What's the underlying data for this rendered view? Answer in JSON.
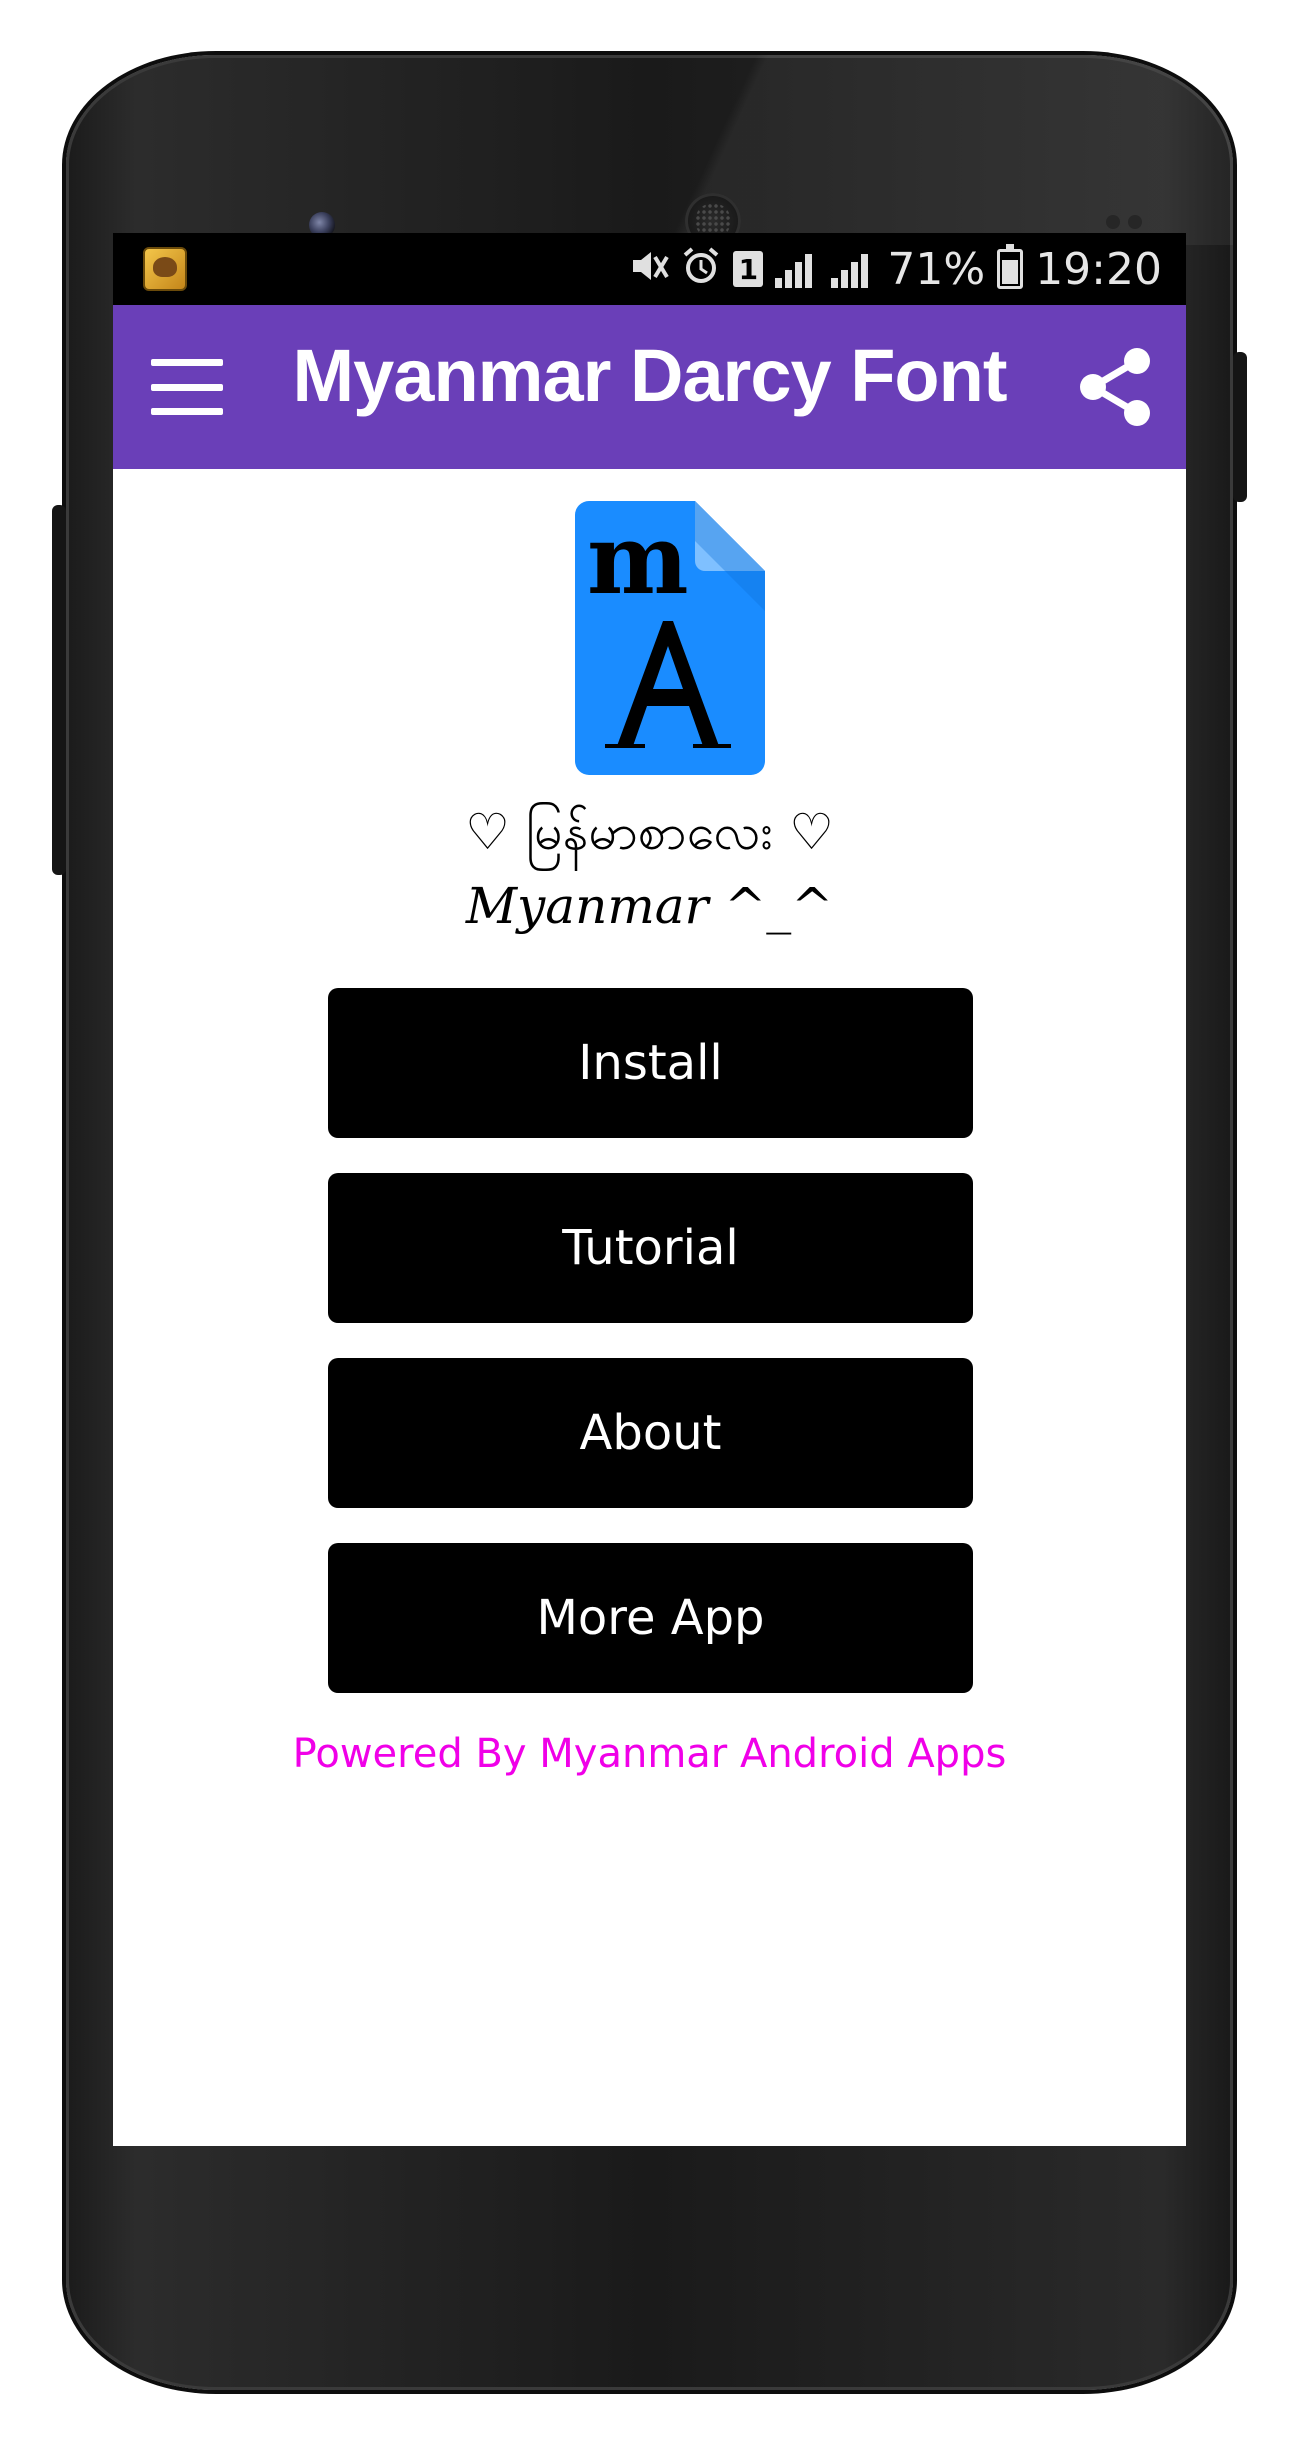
{
  "status_bar": {
    "battery_percent": "71%",
    "time": "19:20",
    "sim_label": "1"
  },
  "app_bar": {
    "title": "Myanmar Darcy Font",
    "background_color": "#6a3fb8"
  },
  "content": {
    "logo_icon": "font-file-icon",
    "tagline_line1": "♡ မြန်မာစာလေး ♡",
    "tagline_line2": "Myanmar ^_^",
    "buttons": {
      "install": "Install",
      "tutorial": "Tutorial",
      "about": "About",
      "more_app": "More App"
    },
    "footer": "Powered By Myanmar Android Apps",
    "footer_color": "#f000e8"
  }
}
